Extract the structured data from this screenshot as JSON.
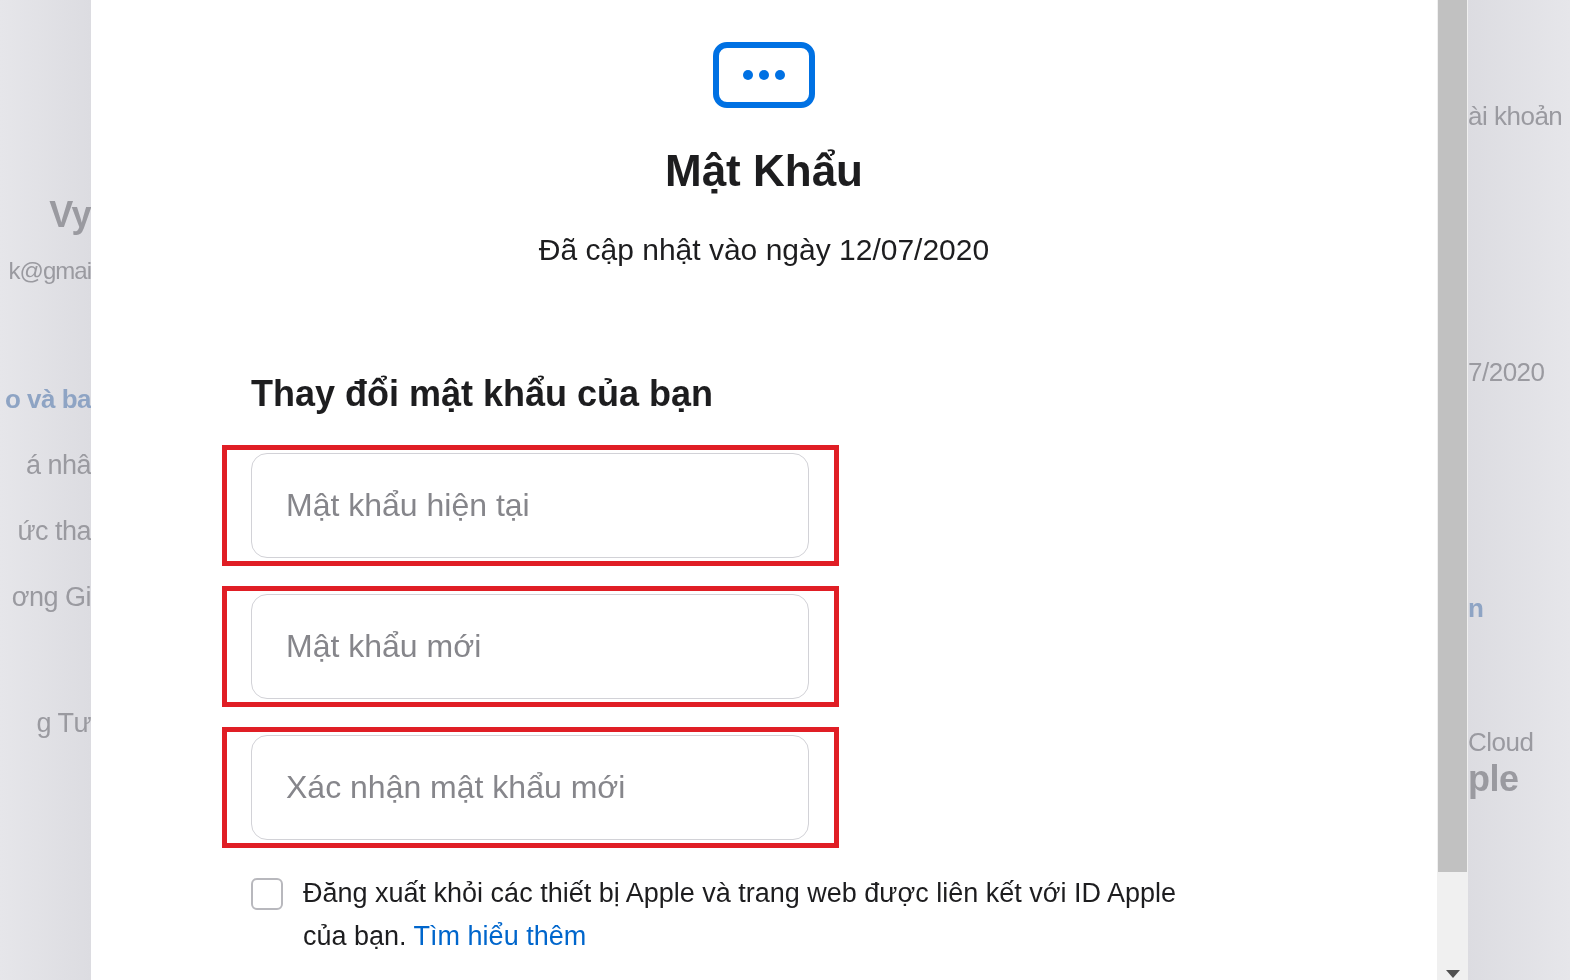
{
  "background_left": [
    {
      "text": "Vy",
      "kind": "name"
    },
    {
      "text": "k@gmai",
      "kind": "email"
    },
    {
      "text": "o và ba",
      "kind": "section"
    },
    {
      "text": "á nhâ",
      "kind": "item"
    },
    {
      "text": "ức tha",
      "kind": "item"
    },
    {
      "text": "ơng Gi",
      "kind": "item"
    },
    {
      "text": "g Tư",
      "kind": "gap-item"
    }
  ],
  "background_right": [
    {
      "text": "ài khoản",
      "kind": "item"
    },
    {
      "text": "7/2020",
      "kind": "date"
    },
    {
      "text": "n",
      "kind": "section"
    },
    {
      "text": "Cloud",
      "kind": "item"
    },
    {
      "text": "ple",
      "kind": "big"
    }
  ],
  "dialog": {
    "title": "Mật Khẩu",
    "subtitle": "Đã cập nhật vào ngày 12/07/2020",
    "heading": "Thay đổi mật khẩu của bạn",
    "fields": [
      {
        "placeholder": "Mật khẩu hiện tại",
        "highlighted": true
      },
      {
        "placeholder": "Mật khẩu mới",
        "highlighted": true
      },
      {
        "placeholder": "Xác nhận mật khẩu mới",
        "highlighted": true
      }
    ],
    "signout": {
      "checked": false,
      "text": "Đăng xuất khỏi các thiết bị Apple và trang web được liên kết với ID Apple của bạn.",
      "link": "Tìm hiểu thêm"
    }
  }
}
